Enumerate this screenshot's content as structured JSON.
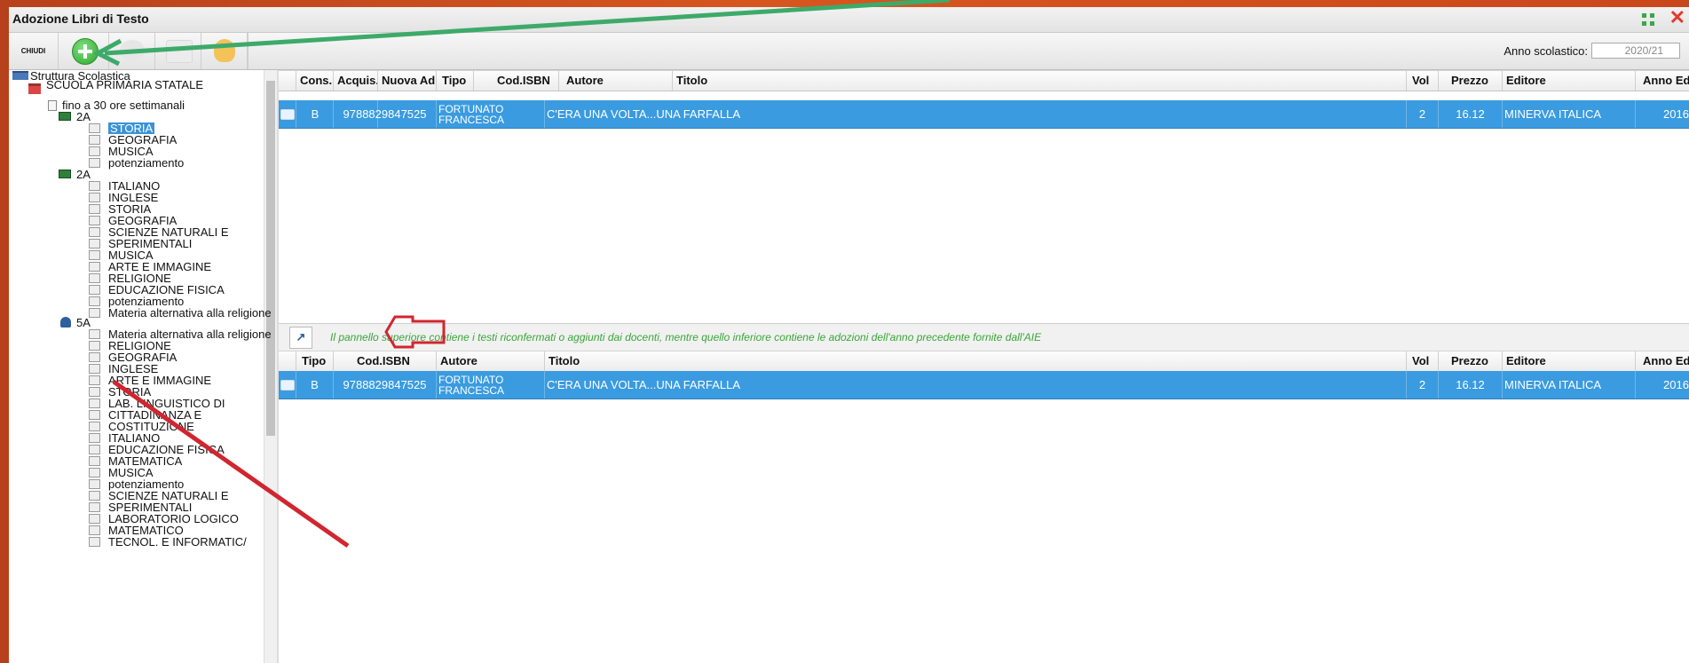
{
  "window": {
    "title": "Adozione Libri di Testo"
  },
  "toolbar": {
    "close_label": "CHIUDI",
    "anno_label": "Anno scolastico:",
    "anno_value": "2020/21",
    "buttons": [
      {
        "icon": "add-icon"
      },
      {
        "icon": "delete-icon"
      },
      {
        "icon": "print-icon"
      },
      {
        "icon": "lightbulb-icon"
      }
    ]
  },
  "tree": {
    "root": "Struttura Scolastica",
    "school": "SCUOLA PRIMARIA STATALE",
    "schedule": "fino a 30 ore settimanali",
    "class1": "2A",
    "class1_items": [
      "STORIA",
      "GEOGRAFIA",
      "MUSICA",
      "potenziamento"
    ],
    "class2": "2A",
    "class2_items": [
      "ITALIANO",
      "INGLESE",
      "STORIA",
      "GEOGRAFIA",
      "SCIENZE NATURALI E",
      "SPERIMENTALI",
      "MUSICA",
      "ARTE E IMMAGINE",
      "RELIGIONE",
      "EDUCAZIONE FISICA",
      "potenziamento",
      "Materia alternativa alla religione"
    ],
    "class3": "5A",
    "class3_items": [
      "Materia alternativa alla religione",
      "RELIGIONE",
      "GEOGRAFIA",
      "INGLESE",
      "ARTE E IMMAGINE",
      "STORIA",
      "LAB. LINGUISTICO DI",
      "CITTADINANZA E",
      "COSTITUZIONE",
      "ITALIANO",
      "EDUCAZIONE FISICA",
      "MATEMATICA",
      "MUSICA",
      "potenziamento",
      "SCIENZE NATURALI E",
      "SPERIMENTALI",
      "LABORATORIO LOGICO",
      "MATEMATICO",
      "TECNOL. E INFORMATIC/"
    ]
  },
  "upper_grid": {
    "columns": [
      "Cons.",
      "Acquis.",
      "Nuova Ad.",
      "Tipo",
      "Cod.ISBN",
      "Autore",
      "Titolo",
      "Vol",
      "Prezzo",
      "Editore",
      "Anno Ediz."
    ],
    "rows": [
      {
        "tipo": "B",
        "isbn": "9788829847525",
        "autore": "FORTUNATO FRANCESCA",
        "titolo": "C'ERA UNA VOLTA...UNA FARFALLA",
        "vol": "2",
        "prezzo": "16.12",
        "editore": "MINERVA ITALICA",
        "anno": "2016"
      }
    ]
  },
  "info": {
    "text": "Il pannello superiore contiene i testi riconfermati o aggiunti dai docenti, mentre quello inferiore contiene le adozioni dell'anno precedente fornite dall'AIE"
  },
  "lower_grid": {
    "columns": [
      "Tipo",
      "Cod.ISBN",
      "Autore",
      "Titolo",
      "Vol",
      "Prezzo",
      "Editore",
      "Anno Ediz."
    ],
    "rows": [
      {
        "tipo": "B",
        "isbn": "9788829847525",
        "autore": "FORTUNATO FRANCESCA",
        "titolo": "C'ERA UNA VOLTA...UNA FARFALLA",
        "vol": "2",
        "prezzo": "16.12",
        "editore": "MINERVA ITALICA",
        "anno": "2016"
      }
    ]
  },
  "annotation_colors": {
    "green_arrow": "#3daa6a",
    "red_arrow": "#d0262f"
  }
}
